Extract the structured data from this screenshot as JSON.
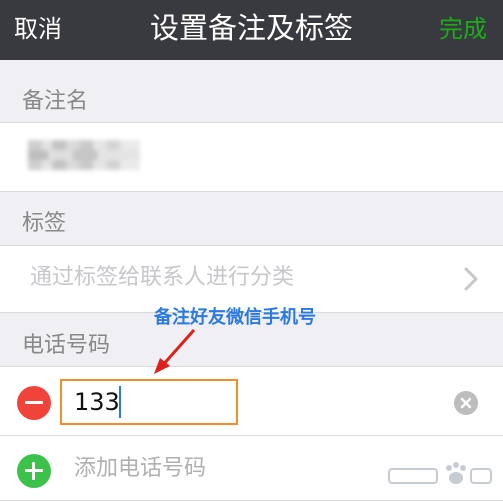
{
  "navbar": {
    "cancel_label": "取消",
    "title": "设置备注及标签",
    "done_label": "完成"
  },
  "remark": {
    "section_label": "备注名"
  },
  "tags": {
    "section_label": "标签",
    "placeholder": "通过标签给联系人进行分类"
  },
  "phone": {
    "section_label": "电话号码",
    "value": "133",
    "add_label": "添加电话号码"
  },
  "annotation": {
    "text": "备注好友微信手机号"
  },
  "colors": {
    "navbar_bg": "#393a3f",
    "done_green": "#1aad19",
    "delete_red": "#f0433a",
    "add_green": "#3cc24a",
    "highlight_orange": "#f0902a",
    "annotation_blue": "#2a7ae2"
  },
  "icons": {
    "delete": "minus-circle-icon",
    "add": "plus-circle-icon",
    "clear": "clear-x-icon",
    "chevron": "chevron-right-icon"
  }
}
